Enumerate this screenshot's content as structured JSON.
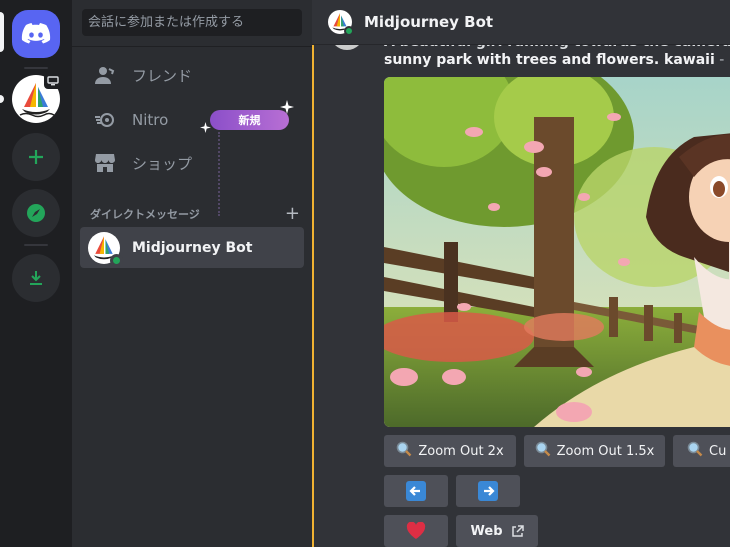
{
  "sidebar": {
    "search_placeholder": "会話に参加または作成する",
    "friends": "フレンド",
    "nitro": "Nitro",
    "nitro_badge": "新規",
    "shop": "ショップ",
    "dm_header": "ダイレクトメッセージ",
    "dm_plus": "+",
    "dm_name": "Midjourney Bot"
  },
  "header": {
    "name": "Midjourney Bot"
  },
  "message": {
    "cut_line": "A beautiful girl running towards the camera with",
    "prompt": "sunny park with trees and flowers. kawaii",
    "suffix": " - Image"
  },
  "buttons": {
    "zoom2": "Zoom Out 2x",
    "zoom15": "Zoom Out 1.5x",
    "custom": "Cu",
    "web": "Web"
  },
  "colors": {
    "accent": "#5865f2",
    "online": "#23a55a",
    "highlight": "#f0b232",
    "badge": "#9b59d0"
  }
}
